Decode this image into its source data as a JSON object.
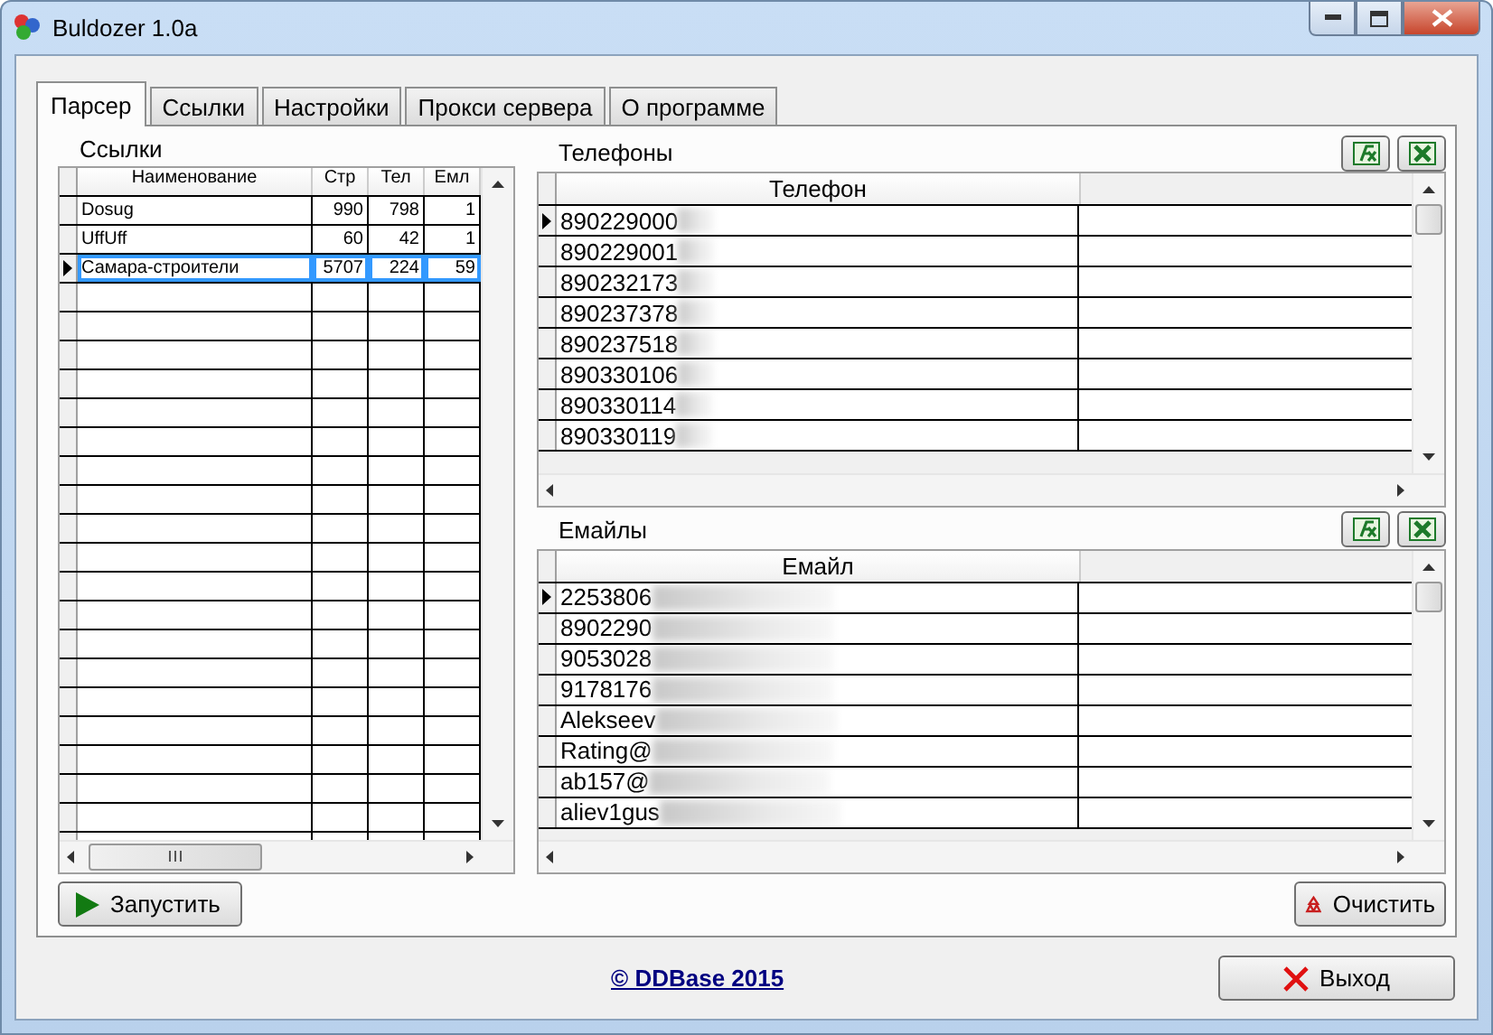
{
  "window": {
    "title": "Buldozer 1.0a"
  },
  "tabs": [
    {
      "label": "Парсер",
      "selected": true
    },
    {
      "label": "Ссылки",
      "selected": false
    },
    {
      "label": "Настройки",
      "selected": false
    },
    {
      "label": "Прокси сервера",
      "selected": false
    },
    {
      "label": "О программе",
      "selected": false
    }
  ],
  "links": {
    "title": "Ссылки",
    "columns": [
      "Наименование",
      "Стр",
      "Тел",
      "Емл"
    ],
    "rows": [
      {
        "name": "Dosug",
        "pages": "990",
        "phones": "798",
        "emails": "1",
        "selected": false
      },
      {
        "name": "UffUff",
        "pages": "60",
        "phones": "42",
        "emails": "1",
        "selected": false
      },
      {
        "name": "Самара-строители",
        "pages": "5707",
        "phones": "224",
        "emails": "59",
        "selected": true
      }
    ]
  },
  "phones": {
    "title": "Телефоны",
    "column": "Телефон",
    "rows": [
      {
        "value": "890229000",
        "selected": true
      },
      {
        "value": "890229001",
        "selected": false
      },
      {
        "value": "890232173",
        "selected": false
      },
      {
        "value": "890237378",
        "selected": false
      },
      {
        "value": "890237518",
        "selected": false
      },
      {
        "value": "890330106",
        "selected": false
      },
      {
        "value": "890330114",
        "selected": false
      },
      {
        "value": "890330119",
        "selected": false
      }
    ]
  },
  "emails": {
    "title": "Емайлы",
    "column": "Емайл",
    "rows": [
      {
        "value": "2253806",
        "selected": true
      },
      {
        "value": "8902290",
        "selected": false
      },
      {
        "value": "9053028",
        "selected": false
      },
      {
        "value": "9178176",
        "selected": false
      },
      {
        "value": "Alekseev",
        "selected": false
      },
      {
        "value": "Rating@",
        "selected": false
      },
      {
        "value": "ab157@",
        "selected": false
      },
      {
        "value": "aliev1gus",
        "selected": false
      }
    ]
  },
  "buttons": {
    "run": "Запустить",
    "clear": "Очистить",
    "exit": "Выход"
  },
  "footer_link": "© DDBase 2015"
}
